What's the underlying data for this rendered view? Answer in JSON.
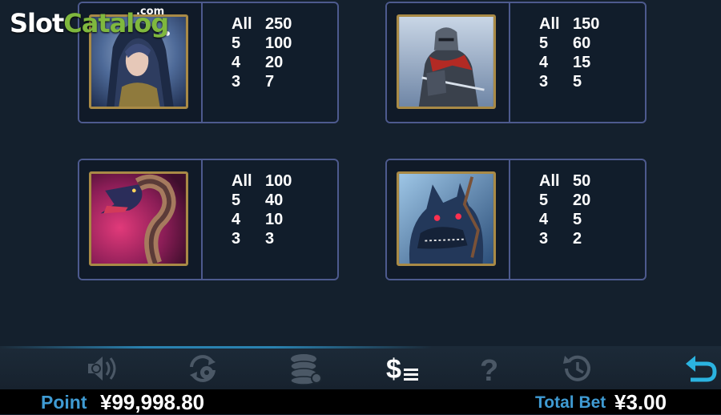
{
  "watermark": {
    "slot": "Slot",
    "catalog": "Catalog",
    "dotcom": ".com"
  },
  "paytable": [
    {
      "symbol": "hooded-heroine",
      "rows": [
        {
          "k": "All",
          "v": "250"
        },
        {
          "k": "5",
          "v": "100"
        },
        {
          "k": "4",
          "v": "20"
        },
        {
          "k": "3",
          "v": "7"
        }
      ]
    },
    {
      "symbol": "armored-knight",
      "rows": [
        {
          "k": "All",
          "v": "150"
        },
        {
          "k": "5",
          "v": "60"
        },
        {
          "k": "4",
          "v": "15"
        },
        {
          "k": "3",
          "v": "5"
        }
      ]
    },
    {
      "symbol": "serpent",
      "rows": [
        {
          "k": "All",
          "v": "100"
        },
        {
          "k": "5",
          "v": "40"
        },
        {
          "k": "4",
          "v": "10"
        },
        {
          "k": "3",
          "v": "3"
        }
      ]
    },
    {
      "symbol": "werewolf",
      "rows": [
        {
          "k": "All",
          "v": "50"
        },
        {
          "k": "5",
          "v": "20"
        },
        {
          "k": "4",
          "v": "5"
        },
        {
          "k": "3",
          "v": "2"
        }
      ]
    }
  ],
  "toolbar": {
    "icons": [
      "sound-settings-icon",
      "autoplay-settings-icon",
      "chips-settings-icon",
      "paytable-icon",
      "help-icon",
      "history-icon",
      "back-icon"
    ],
    "active": "paytable-icon",
    "colors": {
      "inactive": "#4b5866",
      "active": "#ffffff",
      "back": "#2bb3e0"
    }
  },
  "status": {
    "point_label": "Point",
    "point_value": "¥99,998.80",
    "total_bet_label": "Total Bet",
    "total_bet_value": "¥3.00",
    "label_color": "#3f9bd3"
  }
}
